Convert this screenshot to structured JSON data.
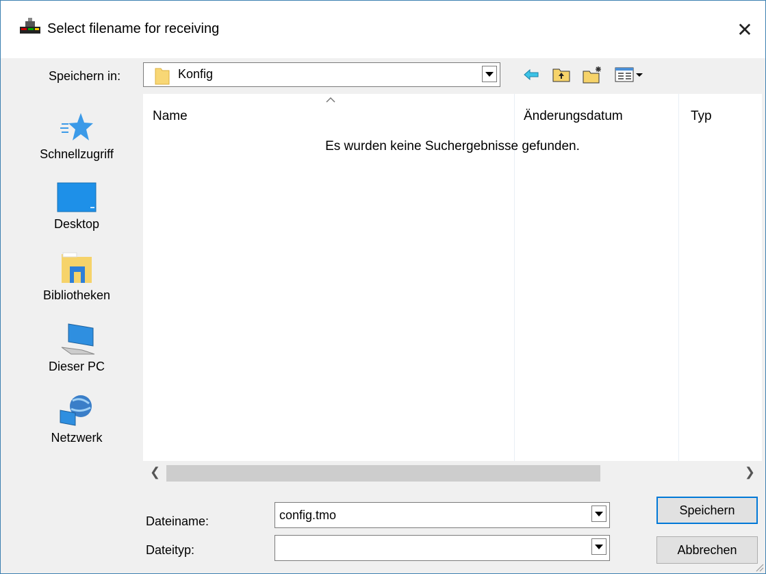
{
  "window": {
    "title": "Select filename for receiving"
  },
  "location": {
    "label": "Speichern in:",
    "folder": "Konfig"
  },
  "toolbar": {
    "icons": [
      "back-icon",
      "up-folder-icon",
      "new-folder-icon",
      "view-menu-icon"
    ]
  },
  "places": [
    {
      "label": "Schnellzugriff",
      "icon": "star-icon"
    },
    {
      "label": "Desktop",
      "icon": "desktop-icon"
    },
    {
      "label": "Bibliotheken",
      "icon": "libraries-icon"
    },
    {
      "label": "Dieser PC",
      "icon": "computer-icon"
    },
    {
      "label": "Netzwerk",
      "icon": "network-icon"
    }
  ],
  "list": {
    "columns": [
      "Name",
      "Änderungsdatum",
      "Typ"
    ],
    "empty_message": "Es wurden keine Suchergebnisse gefunden."
  },
  "filename": {
    "label": "Dateiname:",
    "value": "config.tmo"
  },
  "filetype": {
    "label": "Dateityp:",
    "value": ""
  },
  "buttons": {
    "save": "Speichern",
    "cancel": "Abbrechen"
  },
  "colors": {
    "accent": "#0078d7",
    "border": "#7a7a7a"
  }
}
